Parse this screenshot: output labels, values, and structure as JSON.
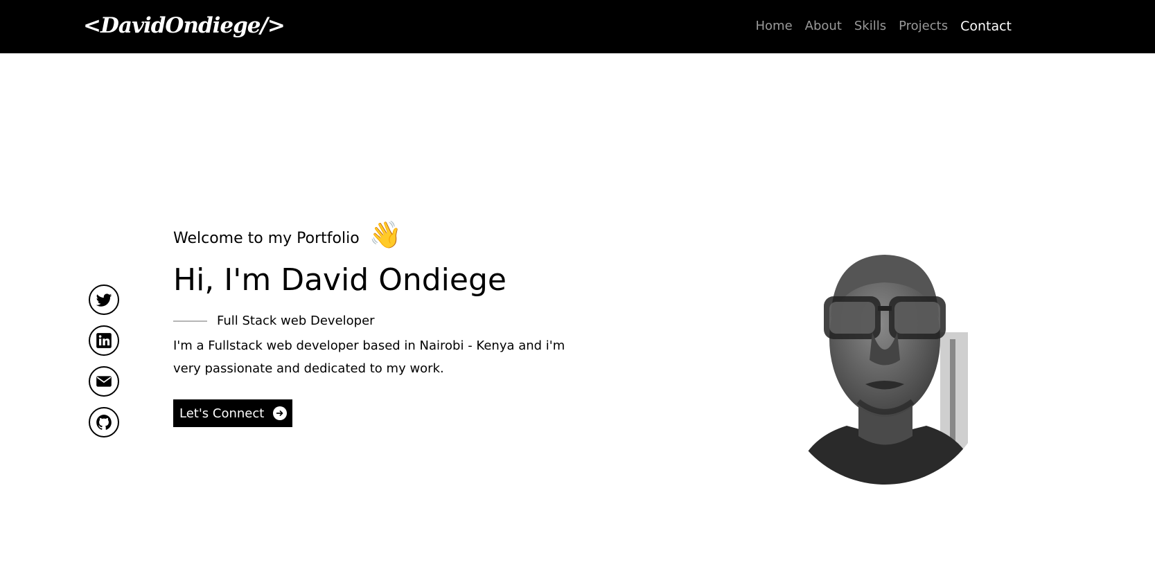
{
  "header": {
    "logo": "<DavidOndiege/>",
    "nav": [
      {
        "label": "Home"
      },
      {
        "label": "About"
      },
      {
        "label": "Skills"
      },
      {
        "label": "Projects"
      },
      {
        "label": "Contact"
      }
    ],
    "active_nav": "Contact",
    "colors": {
      "background": "#000000",
      "nav_text": "#9a9a9a",
      "nav_active": "#ffffff"
    }
  },
  "socials": [
    {
      "icon": "twitter-icon"
    },
    {
      "icon": "linkedin-icon"
    },
    {
      "icon": "envelope-icon"
    },
    {
      "icon": "github-icon"
    }
  ],
  "hero": {
    "welcome": "Welcome to my Portfolio",
    "wave_emoji": "👋",
    "title": "Hi, I'm David Ondiege",
    "role": "Full Stack web Developer",
    "description": "I'm a Fullstack web developer based in Nairobi - Kenya and i'm very passionate and dedicated to my work.",
    "cta_label": "Let's Connect",
    "cta_icon": "arrow-right-circle-icon"
  }
}
